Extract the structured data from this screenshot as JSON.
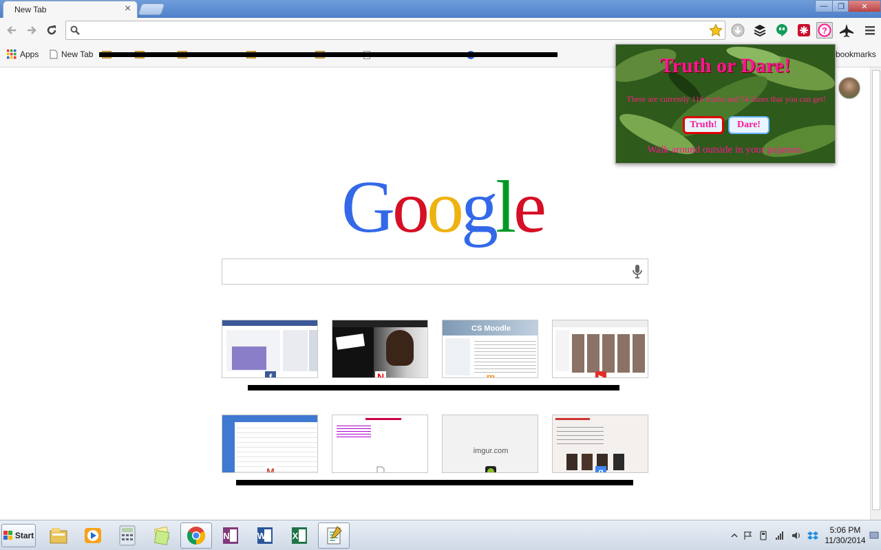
{
  "window": {
    "tab_title": "New Tab",
    "tab_close": "×",
    "min": "—",
    "max": "❐",
    "close": "✕"
  },
  "toolbar": {
    "back": "back-icon",
    "forward": "forward-icon",
    "reload": "reload-icon",
    "omnibox_value": "",
    "extensions": [
      "star-icon",
      "download-icon",
      "layers-icon",
      "hangouts-icon",
      "red-extension-icon",
      "question-icon",
      "jet-icon",
      "menu-icon"
    ]
  },
  "bookmarks": {
    "apps": "Apps",
    "new_tab": "New Tab",
    "other": "bookmarks"
  },
  "google": {
    "letters": [
      {
        "ch": "G",
        "color": "#3369e8"
      },
      {
        "ch": "o",
        "color": "#d50f25"
      },
      {
        "ch": "o",
        "color": "#eeb211"
      },
      {
        "ch": "g",
        "color": "#3369e8"
      },
      {
        "ch": "l",
        "color": "#009925"
      },
      {
        "ch": "e",
        "color": "#d50f25"
      }
    ],
    "search_value": ""
  },
  "tiles": [
    {
      "name": "facebook",
      "favicon": "facebook-icon",
      "label": "",
      "color": "#3b5998"
    },
    {
      "name": "netflix",
      "favicon": "netflix-icon",
      "label": "",
      "color": "#e50914"
    },
    {
      "name": "cs-moodle",
      "favicon": "moodle-icon",
      "label": "",
      "color": "#f7931e"
    },
    {
      "name": "youtube",
      "favicon": "youtube-icon",
      "label": "",
      "color": "#e52d27"
    },
    {
      "name": "gmail",
      "favicon": "gmail-icon",
      "label": "",
      "color": "#d14836"
    },
    {
      "name": "document",
      "favicon": "page-icon",
      "label": "",
      "color": "#888888"
    },
    {
      "name": "imgur",
      "favicon": "imgur-icon",
      "label": "imgur.com",
      "color": "#85bf25"
    },
    {
      "name": "google-site",
      "favicon": "google-plus-icon",
      "label": "",
      "color": "#4285f4"
    }
  ],
  "popup": {
    "title": "Truth or Dare!",
    "count_text": "There are currently 116 truths and 54 dares that you can get!",
    "truth_label": "Truth!",
    "dare_label": "Dare!",
    "dare_text": "Walk around outside in your pajamas.",
    "accent": "#ff1493"
  },
  "taskbar": {
    "start": "Start",
    "apps": [
      "file-explorer-icon",
      "media-player-icon",
      "calculator-icon",
      "sticky-notes-icon",
      "chrome-icon",
      "onenote-icon",
      "word-icon",
      "excel-icon",
      "notepad-icon"
    ],
    "time": "5:06 PM",
    "date": "11/30/2014"
  }
}
